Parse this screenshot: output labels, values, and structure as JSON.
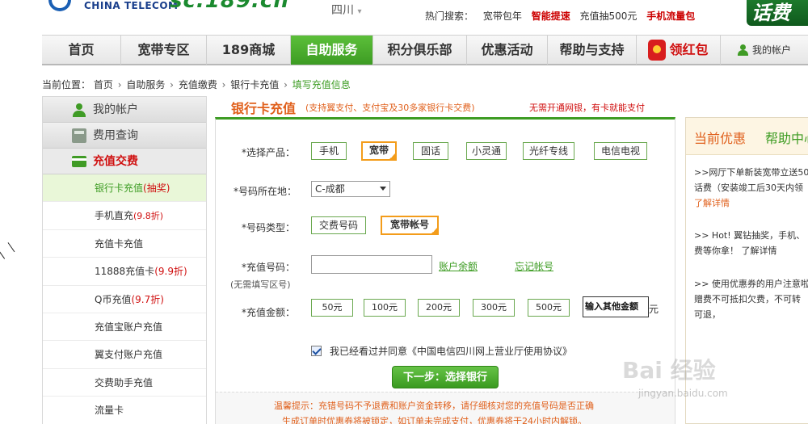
{
  "header": {
    "logo_text": "CHINA TELECOM",
    "site_domain": "sc.189.cn",
    "region": "四川",
    "region_caret": "▾",
    "hot_search_label": "热门搜索：",
    "hot_search_items": [
      "宽带包年",
      "智能提速",
      "充值抽500元",
      "手机流量包"
    ],
    "promo_banner": "话费充"
  },
  "nav": {
    "items": [
      "首页",
      "宽带专区",
      "189商城",
      "自助服务",
      "积分俱乐部",
      "优惠活动",
      "帮助与支持"
    ],
    "active_index": 3,
    "red_packet_label": "领红包",
    "account_label": "我的帐户"
  },
  "breadcrumb": {
    "prefix": "当前位置：",
    "items": [
      "首页",
      "自助服务",
      "充值缴费",
      "银行卡充值"
    ],
    "current": "填写充值信息"
  },
  "sidebar": {
    "headers": [
      "我的帐户",
      "费用查询",
      "充值交费"
    ],
    "items": [
      {
        "label": "银行卡充值",
        "tag": "(抽奖)"
      },
      {
        "label": "手机直充",
        "tag": "(9.8折)"
      },
      {
        "label": "充值卡充值",
        "tag": ""
      },
      {
        "label": "11888充值卡",
        "tag": "(9.9折)"
      },
      {
        "label": "Q币充值",
        "tag": "(9.7折)"
      },
      {
        "label": "充值宝账户充值",
        "tag": ""
      },
      {
        "label": "翼支付账户充值",
        "tag": ""
      },
      {
        "label": "交费助手充值",
        "tag": ""
      },
      {
        "label": "流量卡",
        "tag": ""
      }
    ],
    "active_index": 0
  },
  "main": {
    "title": "银行卡充值",
    "subtitle": "(支持翼支付、支付宝及30多家银行卡交费)",
    "notice": "无需开通网银，有卡就能支付",
    "product_label": "*选择产品：",
    "products": [
      "手机",
      "宽带",
      "固话",
      "小灵通",
      "光纤专线",
      "电信电视"
    ],
    "selected_product_index": 1,
    "area_label": "*号码所在地：",
    "area_value": "C-成都",
    "type_label": "*号码类型：",
    "types": [
      "交费号码",
      "宽带帐号"
    ],
    "selected_type_index": 1,
    "number_label": "*充值号码：",
    "number_value": "",
    "link_balance": "账户余额",
    "link_forgot": "忘记帐号",
    "number_hint": "(无需填写区号)",
    "amount_label": "*充值金额：",
    "amounts": [
      "50元",
      "100元",
      "200元",
      "300元",
      "500元"
    ],
    "amount_other_placeholder": "输入其他金额",
    "amount_unit": "元",
    "agree_text": "我已经看过并同意《中国电信四川网上营业厅使用协议》",
    "agree_checked": true,
    "next_button": "下一步：选择银行",
    "tip_line1": "温馨提示：充错号码不予退费和账户资金转移，请仔细核对您的充值号码是否正确",
    "tip_line2": "生成订单时优惠券将被锁定，如订单未完成支付，优惠券将于24小时内解锁。"
  },
  "right_panel": {
    "tab_active": "当前优惠",
    "tab_other": "帮助中心",
    "item1_lines": [
      ">>网厅下单新装宽带立送50",
      "话费（安装竣工后30天内领",
      "了解详情"
    ],
    "item2_lines": [
      ">> Hot! 翼钻抽奖，手机、",
      "费等你拿！ 了解详情"
    ],
    "item3_lines": [
      ">> 使用优惠券的用户注意啦",
      "赠费不可抵扣欠费，不可转",
      "可退，"
    ]
  },
  "watermark": {
    "text": "Bai 经验",
    "url": "jingyan.baidu.com"
  },
  "colors": {
    "brand_green": "#3d9c23",
    "accent_orange": "#e0601c",
    "alert_red": "#d01010",
    "selected_border": "#f39c1a"
  }
}
